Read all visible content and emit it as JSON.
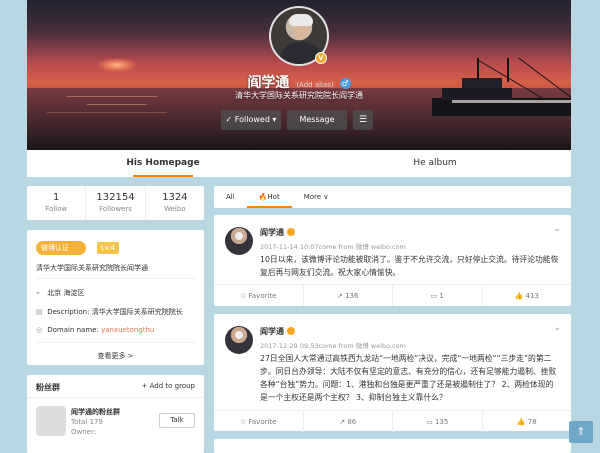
{
  "profile": {
    "name": "阎学通",
    "alias_label": "(Add alias)",
    "gender_symbol": "♂",
    "verified_symbol": "V",
    "description": "清华大学国际关系研究院院长阎学通",
    "follow_label": "Followed ▾",
    "follow_check": "✓",
    "message_label": "Message",
    "more_symbol": "☰"
  },
  "tabs": [
    {
      "label": "His Homepage",
      "active": true
    },
    {
      "label": "He album",
      "active": false
    }
  ],
  "stats": [
    {
      "value": "1",
      "label": "Follow"
    },
    {
      "value": "132154",
      "label": "Followers"
    },
    {
      "value": "1324",
      "label": "Weibo"
    }
  ],
  "info": {
    "verify_badge": "微博认证",
    "level_badge": "Lv.4",
    "verify_text": "清华大学国际关系研究院院长阎学通",
    "location_icon": "location-icon",
    "location": "北京 海淀区",
    "description_label": "Description:",
    "description": "清华大学国际关系研究院院长",
    "domain_label": "Domain name:",
    "domain": "yanxuetongthu",
    "see_more": "查看更多 >"
  },
  "fans_group": {
    "title": "粉丝群",
    "add_label": "+ Add to group",
    "group_name": "阎学通的粉丝群",
    "total": "Total 179",
    "owner": "Owner:",
    "talk_label": "Talk"
  },
  "filter": {
    "items": [
      "All",
      "Hot",
      "More ∨"
    ],
    "fire": "🔥"
  },
  "posts": [
    {
      "author": "阎学通",
      "meta": "2017-11-14 10:07come from 微博 weibo.com",
      "text": "10日以来，该微博评论功能被取消了。鉴于不允许交流，只好停止交流。待评论功能恢复后再与网友们交流。祝大家心情愉快。",
      "actions": [
        "☆ Favorite",
        "↗ 136",
        "▭ 1",
        "👍 413"
      ]
    },
    {
      "author": "阎学通",
      "meta": "2017-12-29 09:53come from 微博 weibo.com",
      "text": "27日全国人大常通过高铁西九龙站“一地两检”决议，完成“一地两检”“三步走”的第二步。同日台办领导：大陆不仅有坚定的意志、有充分的信心，还有足够能力遏制、挫败各种“台独”势力。问题：1、港独和台独是更严重了还是被遏制住了？ 2、两检体现的是一个主权还是两个主权？ 3、抑制台独主义靠什么？",
      "actions": [
        "☆ Favorite",
        "↗ 86",
        "▭ 135",
        "👍 78"
      ]
    }
  ],
  "to_top": "⇑"
}
